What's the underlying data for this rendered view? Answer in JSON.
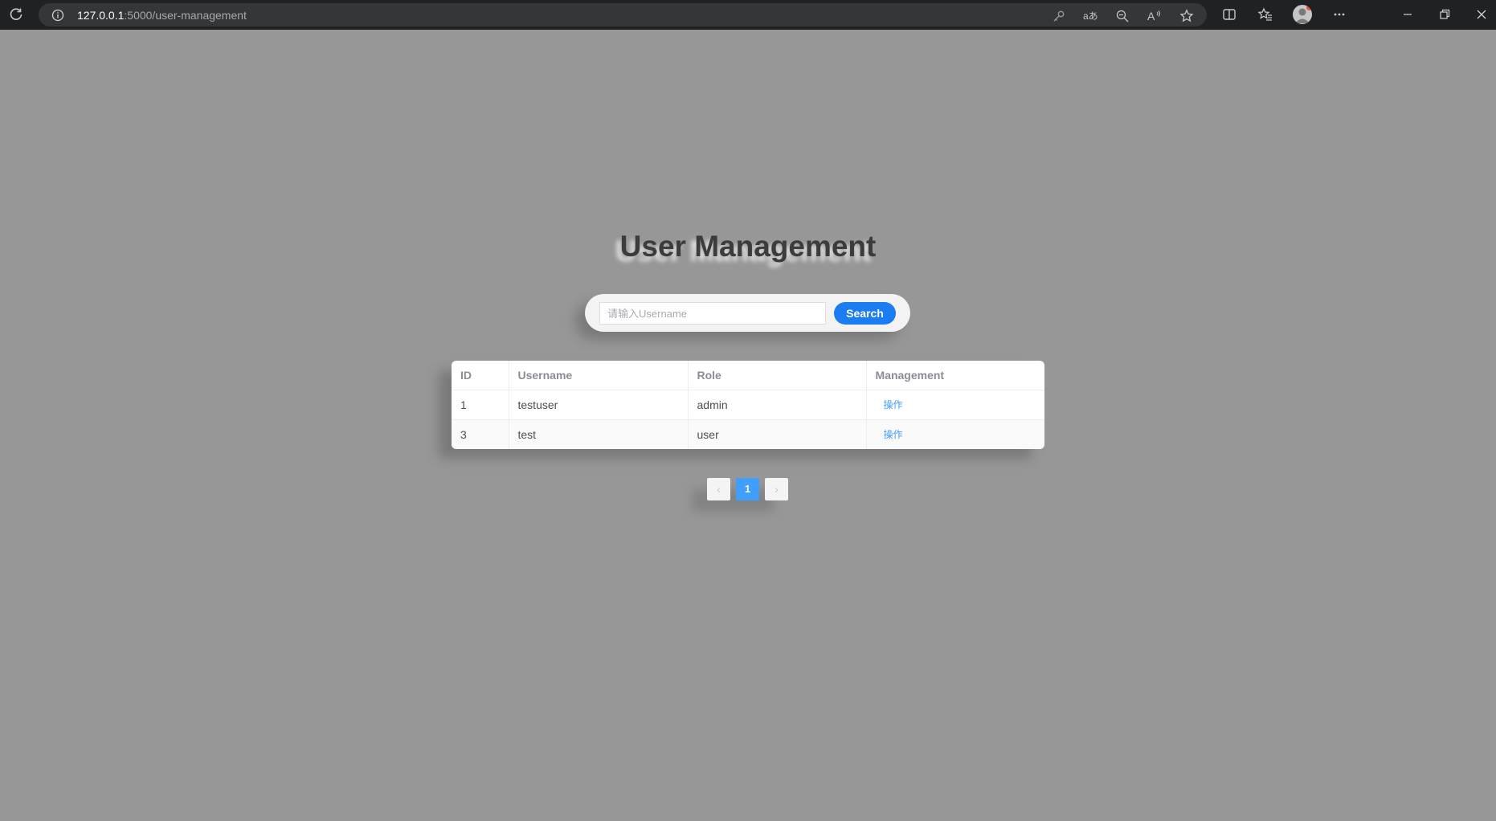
{
  "browser": {
    "url_host": "127.0.0.1",
    "url_path": ":5000/user-management"
  },
  "page": {
    "title": "User Management"
  },
  "search": {
    "placeholder": "请输入Username",
    "value": "",
    "button_label": "Search"
  },
  "table": {
    "headers": {
      "id": "ID",
      "username": "Username",
      "role": "Role",
      "management": "Management"
    },
    "rows": [
      {
        "id": "1",
        "username": "testuser",
        "role": "admin",
        "action": "操作"
      },
      {
        "id": "3",
        "username": "test",
        "role": "user",
        "action": "操作"
      }
    ]
  },
  "pagination": {
    "prev": "‹",
    "current_page": "1",
    "next": "›"
  }
}
